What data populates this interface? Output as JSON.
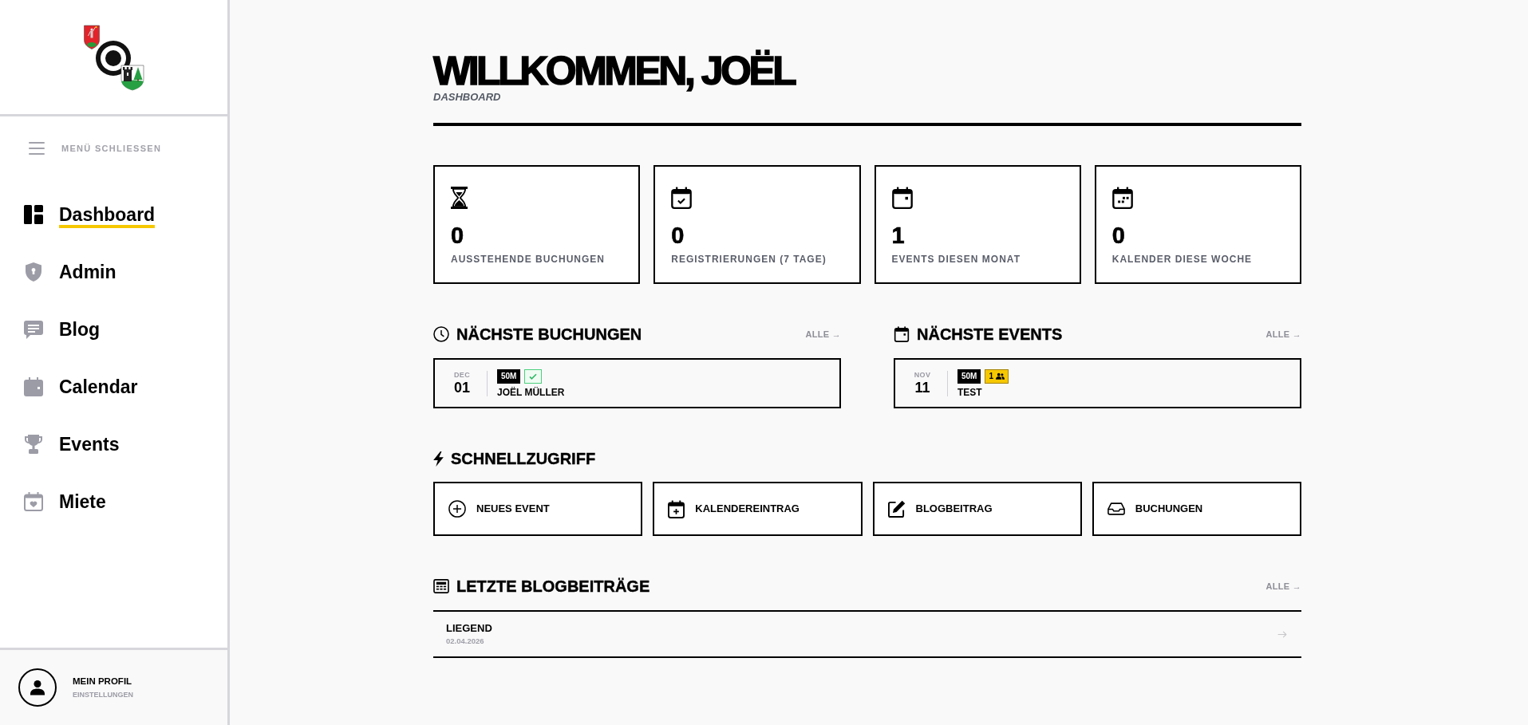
{
  "sidebar": {
    "menu_toggle": "MENÜ SCHLIESSEN",
    "items": [
      {
        "label": "Dashboard",
        "selected": true
      },
      {
        "label": "Admin",
        "selected": false
      },
      {
        "label": "Blog",
        "selected": false
      },
      {
        "label": "Calendar",
        "selected": false
      },
      {
        "label": "Events",
        "selected": false
      },
      {
        "label": "Miete",
        "selected": false
      }
    ],
    "profile": {
      "title": "MEIN PROFIL",
      "subtitle": "EINSTELLUNGEN"
    }
  },
  "header": {
    "title": "WILLKOMMEN, JOËL",
    "subtitle": "DASHBOARD"
  },
  "stats": [
    {
      "value": "0",
      "label": "AUSSTEHENDE BUCHUNGEN"
    },
    {
      "value": "0",
      "label": "REGISTRIERUNGEN (7 TAGE)"
    },
    {
      "value": "1",
      "label": "EVENTS DIESEN MONAT"
    },
    {
      "value": "0",
      "label": "KALENDER DIESE WOCHE"
    }
  ],
  "next_bookings": {
    "title": "NÄCHSTE BUCHUNGEN",
    "link": "ALLE →",
    "items": [
      {
        "month": "DEC",
        "day": "01",
        "tags": [
          {
            "kind": "range",
            "text": "50M"
          },
          {
            "kind": "confirmed"
          }
        ],
        "name": "JOËL MÜLLER"
      }
    ]
  },
  "next_events": {
    "title": "NÄCHSTE EVENTS",
    "link": "ALLE →",
    "items": [
      {
        "month": "NOV",
        "day": "11",
        "tags": [
          {
            "kind": "range",
            "text": "50M"
          },
          {
            "kind": "participants",
            "text": "1"
          }
        ],
        "name": "TEST"
      }
    ]
  },
  "quick_access": {
    "title": "SCHNELLZUGRIFF",
    "items": [
      {
        "label": "NEUES EVENT"
      },
      {
        "label": "KALENDEREINTRAG"
      },
      {
        "label": "BLOGBEITRAG"
      },
      {
        "label": "BUCHUNGEN"
      }
    ]
  },
  "recent_posts": {
    "title": "LETZTE BLOGBEITRÄGE",
    "link": "ALLE →",
    "items": [
      {
        "title": "LIEGEND",
        "date": "02.04.2026"
      }
    ]
  }
}
